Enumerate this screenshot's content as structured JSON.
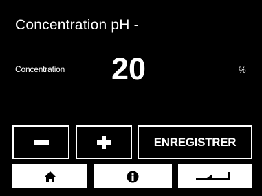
{
  "header": {
    "title": "Concentration pH -"
  },
  "setting": {
    "label": "Concentration",
    "value": "20",
    "unit": "%"
  },
  "controls": {
    "minus_icon": "minus-icon",
    "plus_icon": "plus-icon",
    "save_label": "ENREGISTRER"
  },
  "nav": {
    "home_icon": "home-icon",
    "info_icon": "info-icon",
    "back_icon": "back-arrow-icon"
  },
  "colors": {
    "background": "#000000",
    "foreground": "#ffffff"
  }
}
